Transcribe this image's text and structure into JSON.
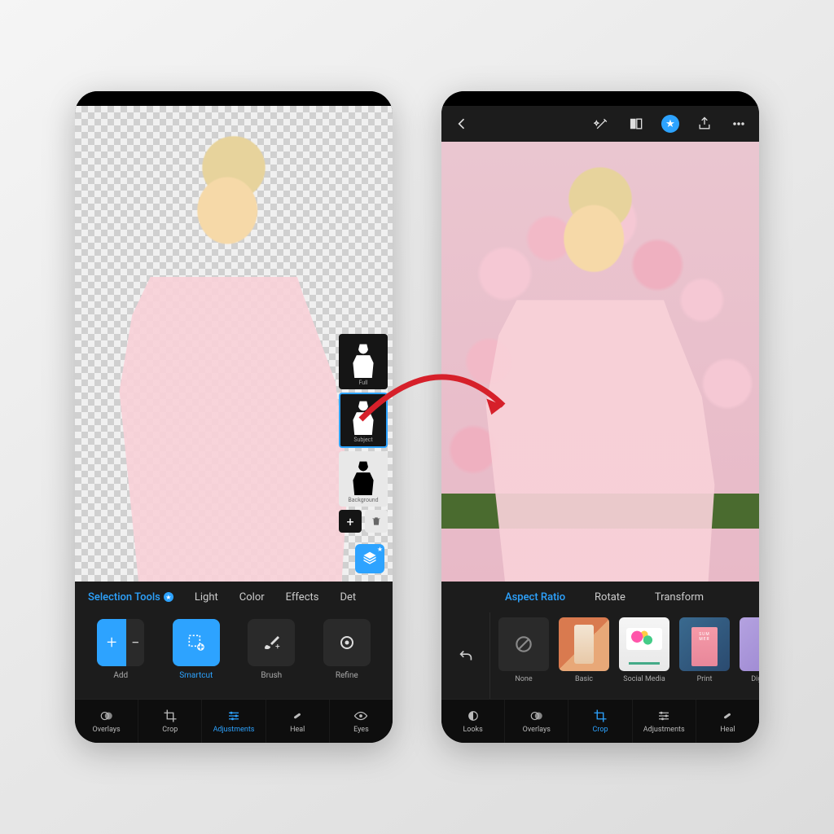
{
  "colors": {
    "accent": "#2da3ff",
    "arrow": "#d6202a"
  },
  "left": {
    "tabs": {
      "selection": "Selection Tools",
      "light": "Light",
      "color": "Color",
      "effects": "Effects",
      "details": "Det"
    },
    "tools": {
      "add": "Add",
      "smartcut": "Smartcut",
      "brush": "Brush",
      "refine": "Refine"
    },
    "nav": {
      "overlays": "Overlays",
      "crop": "Crop",
      "adjustments": "Adjustments",
      "heal": "Heal",
      "eyes": "Eyes"
    },
    "selection_panel": {
      "full": "Full",
      "subject": "Subject",
      "background": "Background"
    }
  },
  "right": {
    "crop_tabs": {
      "aspect": "Aspect Ratio",
      "rotate": "Rotate",
      "transform": "Transform"
    },
    "presets": {
      "none": "None",
      "basic": "Basic",
      "social": "Social Media",
      "print": "Print",
      "digital": "Digital A"
    },
    "nav": {
      "looks": "Looks",
      "overlays": "Overlays",
      "crop": "Crop",
      "adjustments": "Adjustments",
      "heal": "Heal"
    }
  }
}
